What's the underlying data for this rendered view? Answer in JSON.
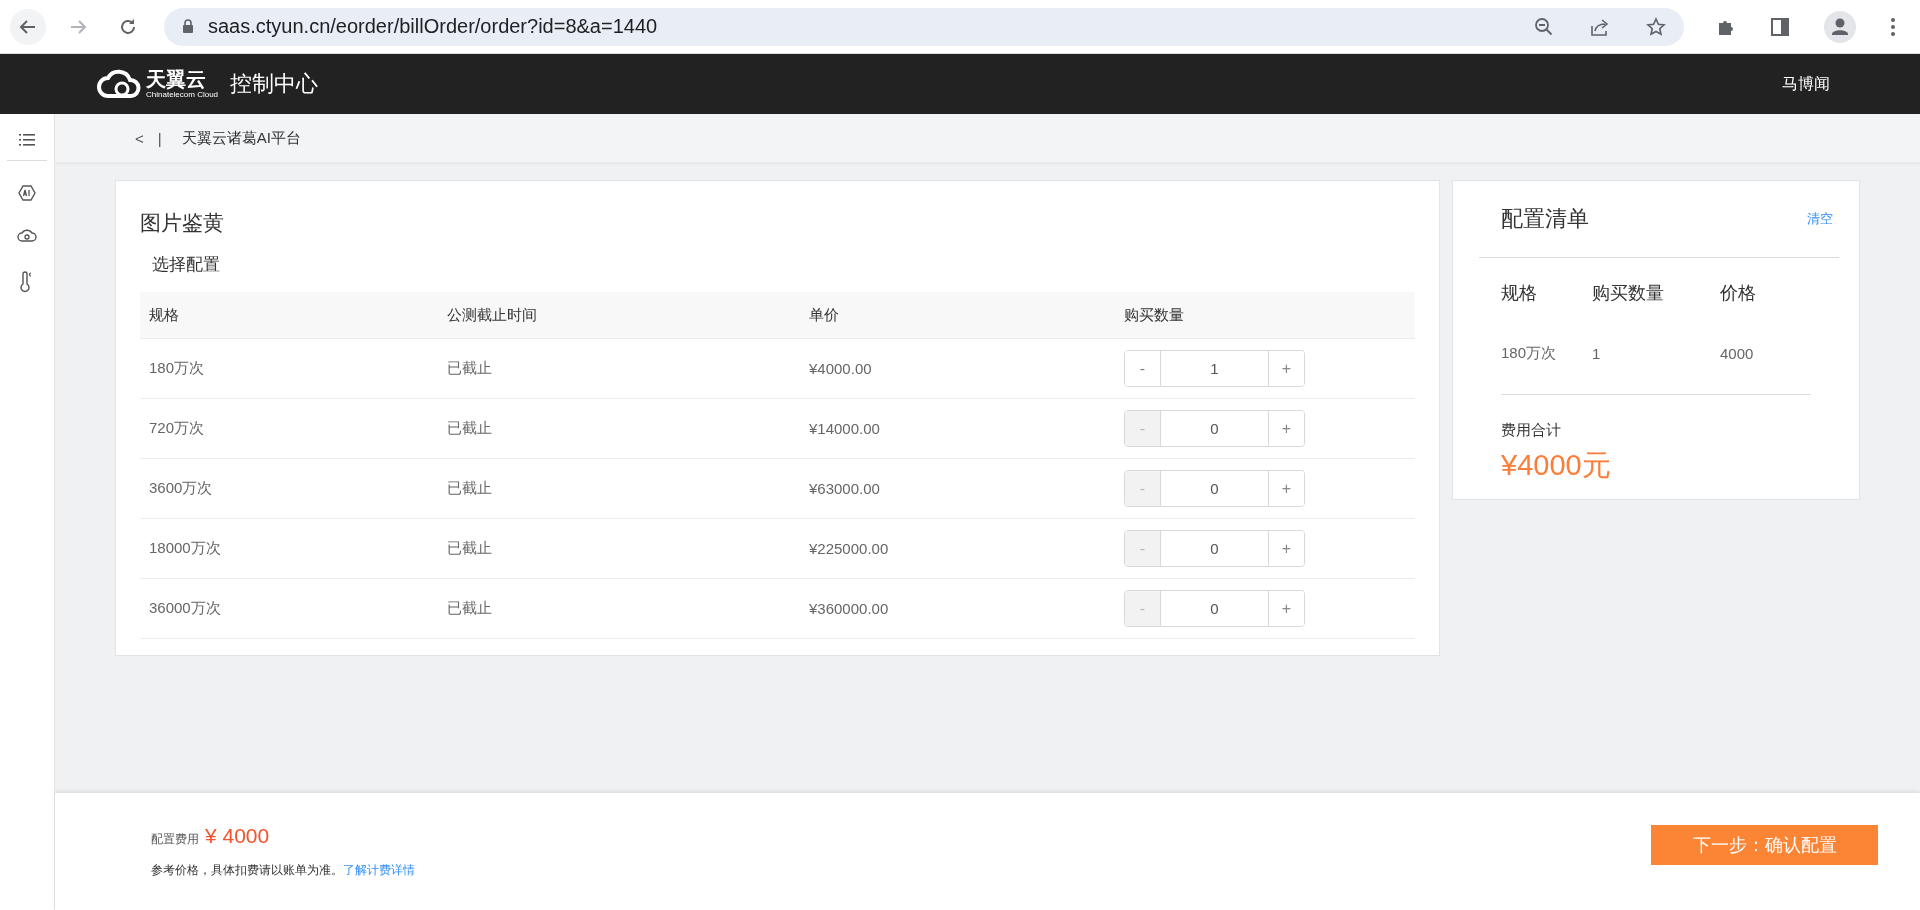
{
  "browser": {
    "url": "saas.ctyun.cn/eorder/billOrder/order?id=8&a=1440",
    "forward_disabled": true
  },
  "header": {
    "logo_text": "天翼云",
    "logo_subtext": "Chinatelecom Cloud",
    "title": "控制中心",
    "user": "马博闻"
  },
  "breadcrumb": {
    "back": "<",
    "separator": "|",
    "title": "天翼云诸葛AI平台"
  },
  "product": {
    "title": "图片鉴黄",
    "section": "选择配置",
    "columns": [
      "规格",
      "公测截止时间",
      "单价",
      "购买数量"
    ],
    "rows": [
      {
        "spec": "180万次",
        "deadline": "已截止",
        "price": "¥4000.00",
        "minus": "-",
        "quantity": "1",
        "plus": "+",
        "minus_disabled": false
      },
      {
        "spec": "720万次",
        "deadline": "已截止",
        "price": "¥14000.00",
        "minus": "-",
        "quantity": "0",
        "plus": "+",
        "minus_disabled": true
      },
      {
        "spec": "3600万次",
        "deadline": "已截止",
        "price": "¥63000.00",
        "minus": "-",
        "quantity": "0",
        "plus": "+",
        "minus_disabled": true
      },
      {
        "spec": "18000万次",
        "deadline": "已截止",
        "price": "¥225000.00",
        "minus": "-",
        "quantity": "0",
        "plus": "+",
        "minus_disabled": true
      },
      {
        "spec": "36000万次",
        "deadline": "已截止",
        "price": "¥360000.00",
        "minus": "-",
        "quantity": "0",
        "plus": "+",
        "minus_disabled": true
      }
    ]
  },
  "summary": {
    "title": "配置清单",
    "clear": "清空",
    "columns": [
      "规格",
      "购买数量",
      "价格"
    ],
    "rows": [
      {
        "spec": "180万次",
        "quantity": "1",
        "price": "4000"
      }
    ],
    "total_label": "费用合计",
    "total": "¥4000元"
  },
  "footer": {
    "fee_label": "配置费用",
    "fee": "¥ 4000",
    "note": "参考价格，具体扣费请以账单为准。",
    "link": "了解计费详情",
    "next": "下一步：确认配置"
  }
}
